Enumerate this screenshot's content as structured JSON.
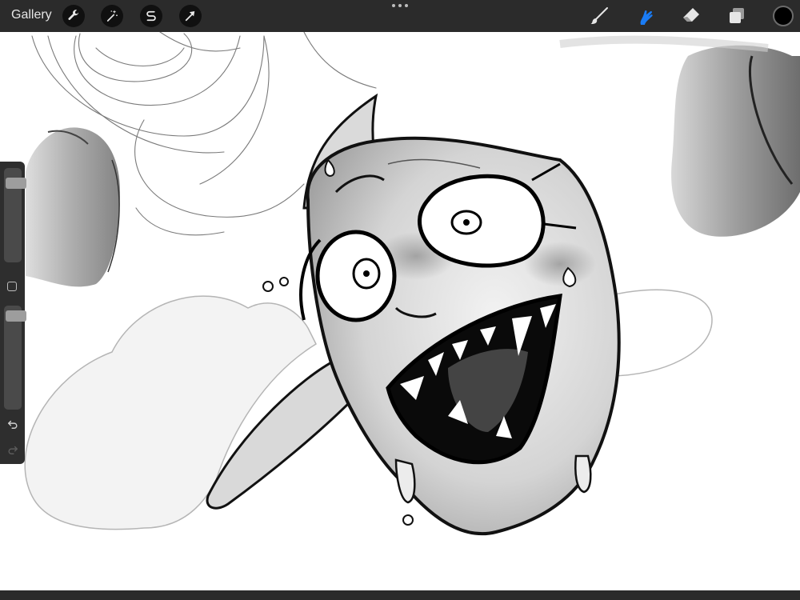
{
  "topbar": {
    "gallery_label": "Gallery",
    "left_tools": [
      {
        "name": "actions",
        "icon": "wrench-icon"
      },
      {
        "name": "adjustments",
        "icon": "magic-wand-icon"
      },
      {
        "name": "selection",
        "icon": "selection-s-icon"
      },
      {
        "name": "transform",
        "icon": "arrow-cursor-icon"
      }
    ],
    "right_tools": [
      {
        "name": "paint",
        "icon": "brush-icon",
        "active": false
      },
      {
        "name": "smudge",
        "icon": "smudge-finger-icon",
        "active": true
      },
      {
        "name": "erase",
        "icon": "eraser-icon",
        "active": false
      },
      {
        "name": "layers",
        "icon": "layers-icon",
        "active": false
      }
    ],
    "active_color": "#000000",
    "accent_color": "#1a7cf5"
  },
  "sidebar": {
    "brush_size": 0.88,
    "brush_opacity": 0.95,
    "undo_icon": "undo-arrow-icon",
    "redo_icon": "redo-arrow-icon"
  }
}
